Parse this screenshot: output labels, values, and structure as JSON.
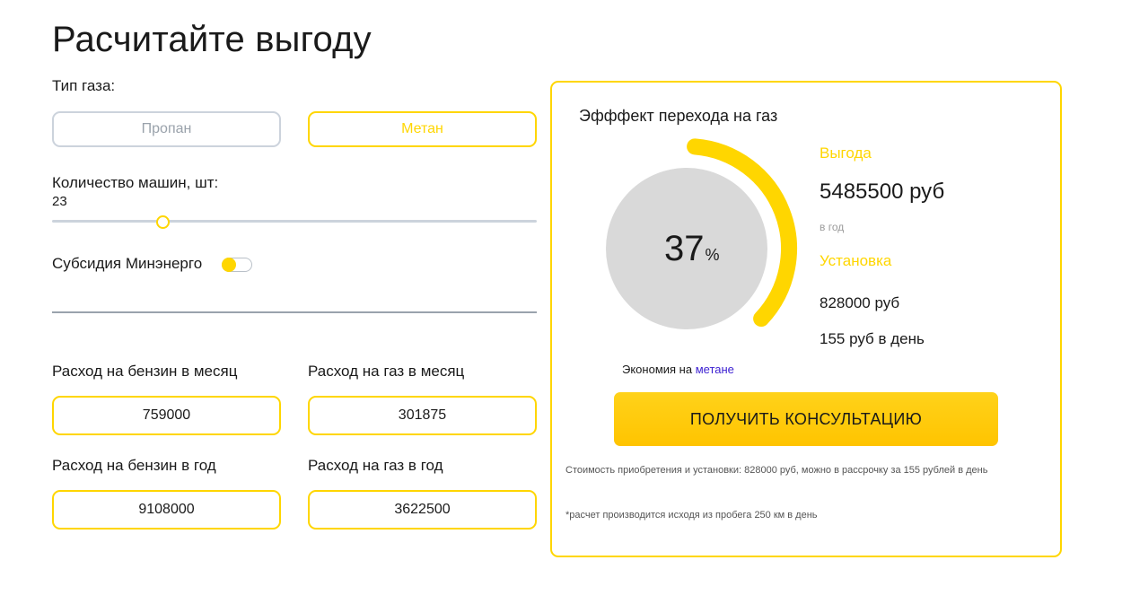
{
  "page": {
    "title": "Расчитайте выгоду"
  },
  "gas_type": {
    "label": "Тип газа:",
    "options": [
      {
        "label": "Пропан",
        "selected": false
      },
      {
        "label": "Метан",
        "selected": true
      }
    ]
  },
  "cars": {
    "label": "Количество машин, шт:",
    "value": "23"
  },
  "subsidy": {
    "label": "Субсидия Минэнерго",
    "enabled": false
  },
  "costs": {
    "petrol_month_label": "Расход на бензин в месяц",
    "petrol_month_value": "759000",
    "gas_month_label": "Расход на газ в месяц",
    "gas_month_value": "301875",
    "petrol_year_label": "Расход на бензин в год",
    "petrol_year_value": "9108000",
    "gas_year_label": "Расход на газ в год",
    "gas_year_value": "3622500"
  },
  "result": {
    "heading": "Эфффект перехода на газ",
    "percent": "37",
    "percent_sign": "%",
    "savings_fraction": 0.37,
    "benefit_label": "Выгода",
    "benefit_value": "5485500 руб",
    "benefit_period": "в год",
    "install_label": "Установка",
    "install_value": "828000 руб",
    "install_per_day": "155 руб в день",
    "economy_prefix": "Экономия на",
    "economy_link": "метане",
    "cta_label": "ПОЛУЧИТЬ КОНСУЛЬТАЦИЮ",
    "note_cost": "Стоимость приобретения и установки: 828000 руб, можно в рассрочку за 155 рублей в день",
    "note_mileage": "*расчет производится исходя из пробега 250 км в день"
  },
  "colors": {
    "accent": "#ffd600",
    "circle": "#d9d9d9",
    "link": "#3b1fd1",
    "muted_border": "#ccd3dc"
  }
}
